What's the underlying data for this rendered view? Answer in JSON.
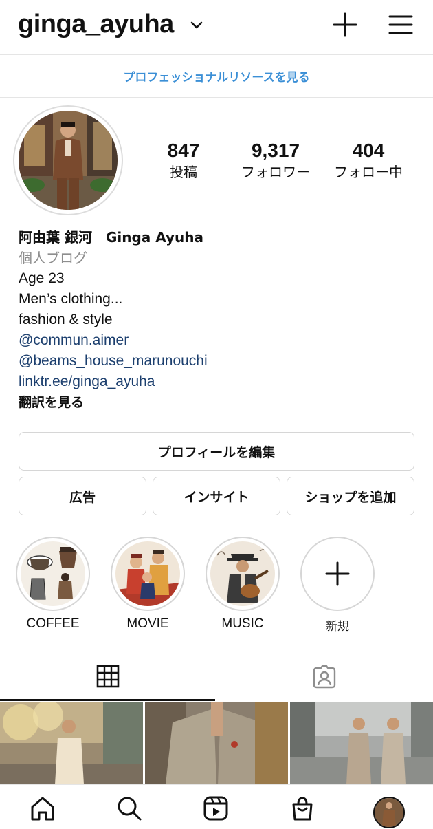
{
  "header": {
    "username": "ginga_ayuha",
    "icons": [
      "chevron-down-icon",
      "plus-icon",
      "menu-icon"
    ]
  },
  "pro_banner": {
    "label": "プロフェッショナルリソースを見る"
  },
  "stats": [
    {
      "value": "847",
      "label": "投稿"
    },
    {
      "value": "9,317",
      "label": "フォロワー"
    },
    {
      "value": "404",
      "label": "フォロー中"
    }
  ],
  "bio": {
    "name": "阿由葉 銀河　Ginga Ayuha",
    "category": "個人ブログ",
    "lines": [
      "Age 23",
      "Men’s clothing...",
      "fashion & style"
    ],
    "links": [
      "@commun.aimer",
      "@beams_house_marunouchi",
      "linktr.ee/ginga_ayuha"
    ],
    "translate": "翻訳を見る"
  },
  "buttons": {
    "edit_profile": "プロフィールを編集",
    "ads": "広告",
    "insights": "インサイト",
    "add_shop": "ショップを追加"
  },
  "highlights": [
    {
      "label": "COFFEE"
    },
    {
      "label": "MOVIE"
    },
    {
      "label": "MUSIC"
    },
    {
      "label": "新規"
    }
  ],
  "tabs": [
    {
      "name": "grid-icon",
      "active": true
    },
    {
      "name": "tagged-icon",
      "active": false
    }
  ],
  "bottom_nav": [
    "home-icon",
    "search-icon",
    "reels-icon",
    "shop-icon",
    "profile-avatar"
  ],
  "colors": {
    "link": "#1c3f6e",
    "pro_banner": "#3b8fd6",
    "border": "#d6d6d6",
    "muted": "#8e8e8e"
  }
}
